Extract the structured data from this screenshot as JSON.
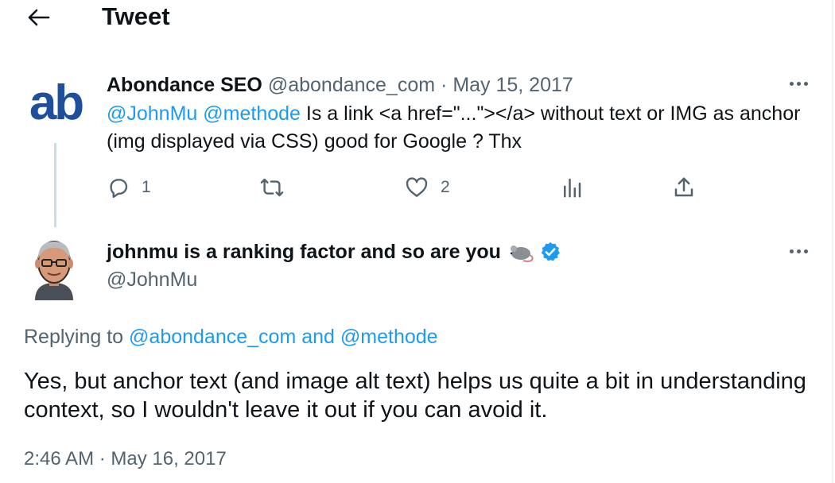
{
  "header": {
    "title": "Tweet",
    "back_icon": "arrow-left-icon"
  },
  "parent_tweet": {
    "avatar_text": "ab",
    "display_name": "Abondance SEO",
    "handle": "@abondance_com",
    "separator": "·",
    "date": "May 15, 2017",
    "mention_1": "@JohnMu",
    "mention_2": "@methode",
    "text": " Is a link <a href=\"...\"></a> without text or IMG as anchor (img displayed via CSS) good for Google ? Thx",
    "actions": {
      "reply_count": "1",
      "retweet_count": "",
      "like_count": "2"
    }
  },
  "reply_tweet": {
    "display_name": "johnmu is a ranking factor and so are you",
    "handle": "@JohnMu",
    "verified": true,
    "replying_prefix": "Replying to",
    "replying_to_1": "@abondance_com",
    "replying_and": "and",
    "replying_to_2": "@methode",
    "text": "Yes, but anchor text (and image alt text) helps us quite a bit in understanding context, so I wouldn't leave it out if you can avoid it.",
    "timestamp": "2:46 AM · May 16, 2017"
  },
  "colors": {
    "accent": "#1d9bf0",
    "muted": "#536471",
    "text": "#0f1419",
    "brand_ab": "#1f4f9c"
  }
}
